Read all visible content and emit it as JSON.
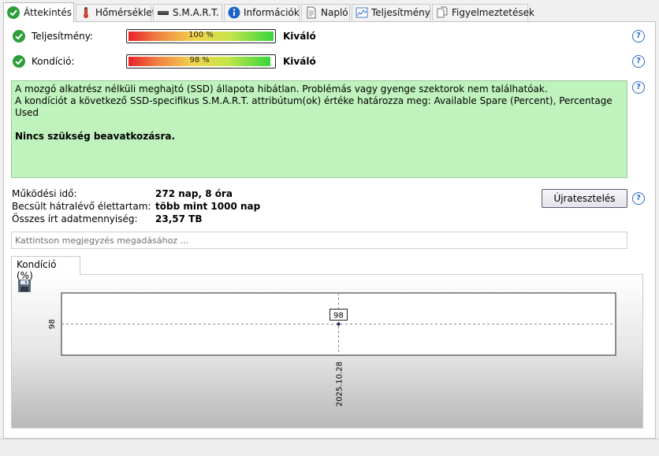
{
  "tabs": [
    {
      "label": "Áttekintés",
      "icon": "check-circle-icon",
      "active": true
    },
    {
      "label": "Hőmérséklet",
      "icon": "thermometer-icon"
    },
    {
      "label": "S.M.A.R.T.",
      "icon": "drive-icon"
    },
    {
      "label": "Információk",
      "icon": "info-icon"
    },
    {
      "label": "Napló",
      "icon": "document-icon"
    },
    {
      "label": "Teljesítmény",
      "icon": "performance-chart-icon"
    },
    {
      "label": "Figyelmeztetések",
      "icon": "copy-document-icon"
    }
  ],
  "performance": {
    "label": "Teljesítmény:",
    "value_text": "100 %",
    "value": 100,
    "status": "Kiváló"
  },
  "condition": {
    "label": "Kondíció:",
    "value_text": "98 %",
    "value": 98,
    "status": "Kiváló"
  },
  "message": {
    "line1": "A mozgó alkatrész nélküli meghajtó (SSD) állapota hibátlan. Problémás vagy gyenge szektorok nem találhatóak.",
    "line2": "A kondíciót a következő SSD-specifikus S.M.A.R.T. attribútum(ok) értéke határozza meg:  Available Spare (Percent), Percentage Used",
    "conclusion": "Nincs szükség beavatkozásra."
  },
  "info": {
    "uptime_label": "Működési idő:",
    "uptime_value": "272 nap, 8 óra",
    "lifetime_label": "Becsült hátralévő élettartam:",
    "lifetime_value": "több mint 1000 nap",
    "written_label": "Összes írt adatmennyiség:",
    "written_value": "23,57 TB"
  },
  "retest_button": "Újratesztelés",
  "note": {
    "placeholder": "Kattintson megjegyzés megadásához ..."
  },
  "chart_tab": "Kondíció  (%)",
  "colors": {
    "status_green": "#2e9e3a",
    "message_bg": "#bff2bd",
    "help_blue": "#2b6cc4"
  },
  "chart_data": {
    "type": "line",
    "title": "Kondíció (%)",
    "x": [
      "2025.10.28"
    ],
    "series": [
      {
        "values": [
          98
        ]
      }
    ],
    "data_labels": [
      "98"
    ],
    "y_tick_labels": [
      "98"
    ],
    "grid": true
  }
}
